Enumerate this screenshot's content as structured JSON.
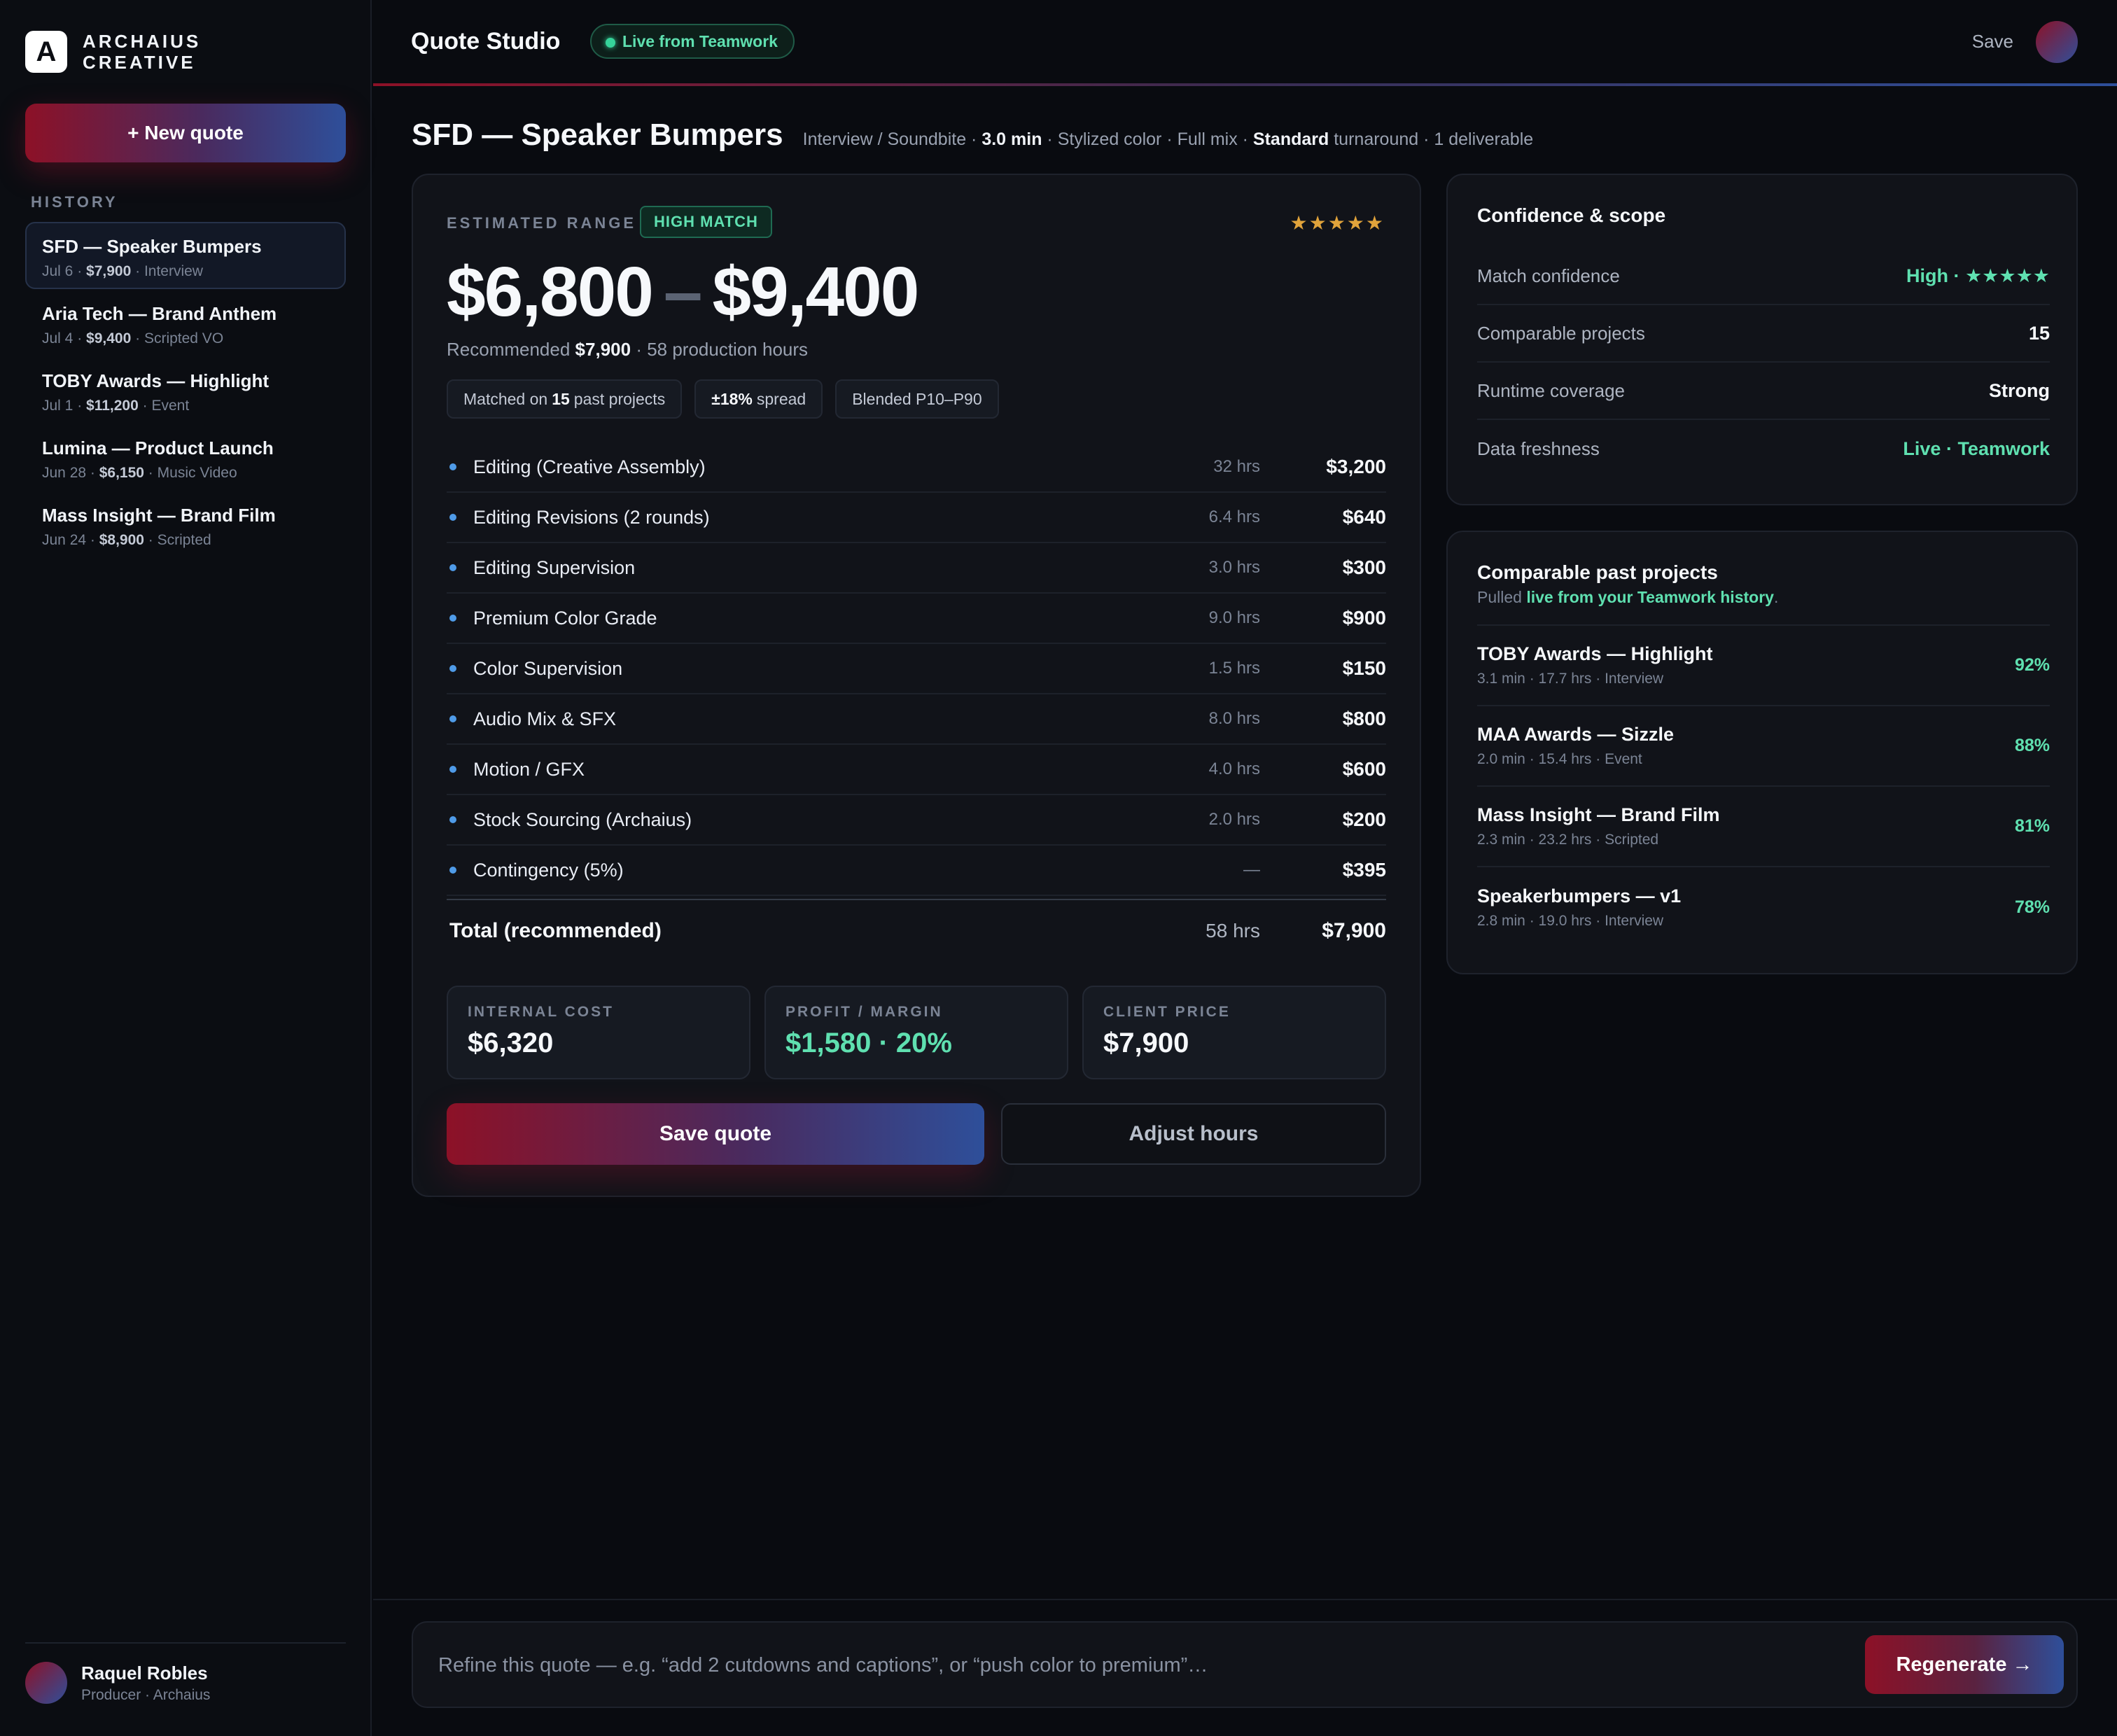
{
  "brand": {
    "logo_letter": "A",
    "line1": "ARCHAIUS",
    "line2": "CREATIVE"
  },
  "sidebar": {
    "new_quote_label": "+ New quote",
    "history_label": "HISTORY",
    "history": [
      {
        "title": "SFD — Speaker Bumpers",
        "date": "Jul 6",
        "price": "$7,900",
        "type": "Interview",
        "active": true
      },
      {
        "title": "Aria Tech — Brand Anthem",
        "date": "Jul 4",
        "price": "$9,400",
        "type": "Scripted VO"
      },
      {
        "title": "TOBY Awards — Highlight",
        "date": "Jul 1",
        "price": "$11,200",
        "type": "Event"
      },
      {
        "title": "Lumina — Product Launch",
        "date": "Jun 28",
        "price": "$6,150",
        "type": "Music Video"
      },
      {
        "title": "Mass Insight — Brand Film",
        "date": "Jun 24",
        "price": "$8,900",
        "type": "Scripted"
      }
    ],
    "user": {
      "name": "Raquel Robles",
      "role": "Producer · Archaius"
    }
  },
  "header": {
    "title": "Quote Studio",
    "live_badge": "Live from Teamwork",
    "save_label": "Save"
  },
  "project": {
    "title": "SFD — Speaker Bumpers",
    "meta": {
      "type": "Interview / Soundbite",
      "runtime": "3.0 min",
      "color": "Stylized color",
      "mix": "Full mix",
      "turnaround_level": "Standard",
      "turnaround_word": "turnaround",
      "deliverables": "1 deliverable"
    }
  },
  "estimate": {
    "label": "ESTIMATED RANGE",
    "match_badge": "HIGH MATCH",
    "stars": "★★★★★",
    "range_low": "$6,800",
    "range_sep": "–",
    "range_high": "$9,400",
    "recommended_prefix": "Recommended",
    "recommended_value": "$7,900",
    "recommended_hours": "· 58 production hours",
    "chips": {
      "matched_prefix": "Matched on",
      "matched_count": "15",
      "matched_suffix": "past projects",
      "spread_value": "±18%",
      "spread_suffix": "spread",
      "blend": "Blended P10–P90"
    },
    "lines": [
      {
        "name": "Editing (Creative Assembly)",
        "hours": "32 hrs",
        "amount": "$3,200"
      },
      {
        "name": "Editing Revisions (2 rounds)",
        "hours": "6.4 hrs",
        "amount": "$640"
      },
      {
        "name": "Editing Supervision",
        "hours": "3.0 hrs",
        "amount": "$300"
      },
      {
        "name": "Premium Color Grade",
        "hours": "9.0 hrs",
        "amount": "$900"
      },
      {
        "name": "Color Supervision",
        "hours": "1.5 hrs",
        "amount": "$150"
      },
      {
        "name": "Audio Mix & SFX",
        "hours": "8.0 hrs",
        "amount": "$800"
      },
      {
        "name": "Motion / GFX",
        "hours": "4.0 hrs",
        "amount": "$600"
      },
      {
        "name": "Stock Sourcing (Archaius)",
        "hours": "2.0 hrs",
        "amount": "$200"
      },
      {
        "name": "Contingency (5%)",
        "hours": "—",
        "amount": "$395"
      }
    ],
    "total": {
      "name": "Total (recommended)",
      "hours": "58 hrs",
      "amount": "$7,900"
    },
    "metrics": {
      "internal_cost_label": "INTERNAL COST",
      "internal_cost_value": "$6,320",
      "profit_label": "PROFIT / MARGIN",
      "profit_value": "$1,580 · 20%",
      "client_price_label": "CLIENT PRICE",
      "client_price_value": "$7,900"
    },
    "save_quote_label": "Save quote",
    "adjust_hours_label": "Adjust hours"
  },
  "confidence": {
    "title": "Confidence & scope",
    "rows": [
      {
        "key": "Match confidence",
        "value": "High · ★★★★★",
        "green": true
      },
      {
        "key": "Comparable projects",
        "value": "15",
        "green": false
      },
      {
        "key": "Runtime coverage",
        "value": "Strong",
        "green": false
      },
      {
        "key": "Data freshness",
        "value": "Live · Teamwork",
        "green": true
      }
    ]
  },
  "comparables": {
    "title": "Comparable past projects",
    "sub_prefix": "Pulled",
    "sub_link": "live from your Teamwork history",
    "sub_suffix": ".",
    "items": [
      {
        "name": "TOBY Awards — Highlight",
        "meta": "3.1 min · 17.7 hrs · Interview",
        "score": "92%"
      },
      {
        "name": "MAA Awards — Sizzle",
        "meta": "2.0 min · 15.4 hrs · Event",
        "score": "88%"
      },
      {
        "name": "Mass Insight — Brand Film",
        "meta": "2.3 min · 23.2 hrs · Scripted",
        "score": "81%"
      },
      {
        "name": "Speakerbumpers — v1",
        "meta": "2.8 min · 19.0 hrs · Interview",
        "score": "78%"
      }
    ]
  },
  "refine": {
    "placeholder": "Refine this quote — e.g. “add 2 cutdowns and captions”, or “push color to premium”…",
    "regenerate_label": "Regenerate →"
  },
  "colors": {
    "accent_red": "#8d1127",
    "accent_blue": "#2e4f9a",
    "green": "#5fe0b0",
    "star": "#e0a33b",
    "bullet": "#4f9be8"
  }
}
